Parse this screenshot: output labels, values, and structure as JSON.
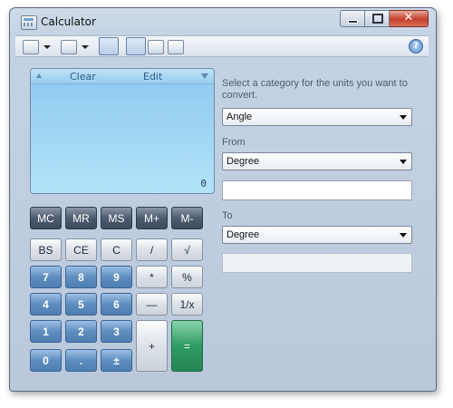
{
  "window": {
    "title": "Calculator"
  },
  "toolbar": {
    "help_label": "?"
  },
  "display": {
    "clear_label": "Clear",
    "edit_label": "Edit",
    "value": "0"
  },
  "memory_keys": [
    "MC",
    "MR",
    "MS",
    "M+",
    "M-"
  ],
  "keys": {
    "bs": "BS",
    "ce": "CE",
    "c": "C",
    "div": "/",
    "sqrt": "√",
    "n7": "7",
    "n8": "8",
    "n9": "9",
    "mul": "*",
    "pct": "%",
    "n4": "4",
    "n5": "5",
    "n6": "6",
    "sub": "—",
    "inv": "1/x",
    "n1": "1",
    "n2": "2",
    "n3": "3",
    "add": "+",
    "eq": "=",
    "n0": "0",
    "dot": ".",
    "pm": "±"
  },
  "converter": {
    "prompt": "Select a category for the units you want to convert.",
    "category": "Angle",
    "from_label": "From",
    "from_unit": "Degree",
    "from_value": "",
    "to_label": "To",
    "to_unit": "Degree",
    "to_value": ""
  }
}
